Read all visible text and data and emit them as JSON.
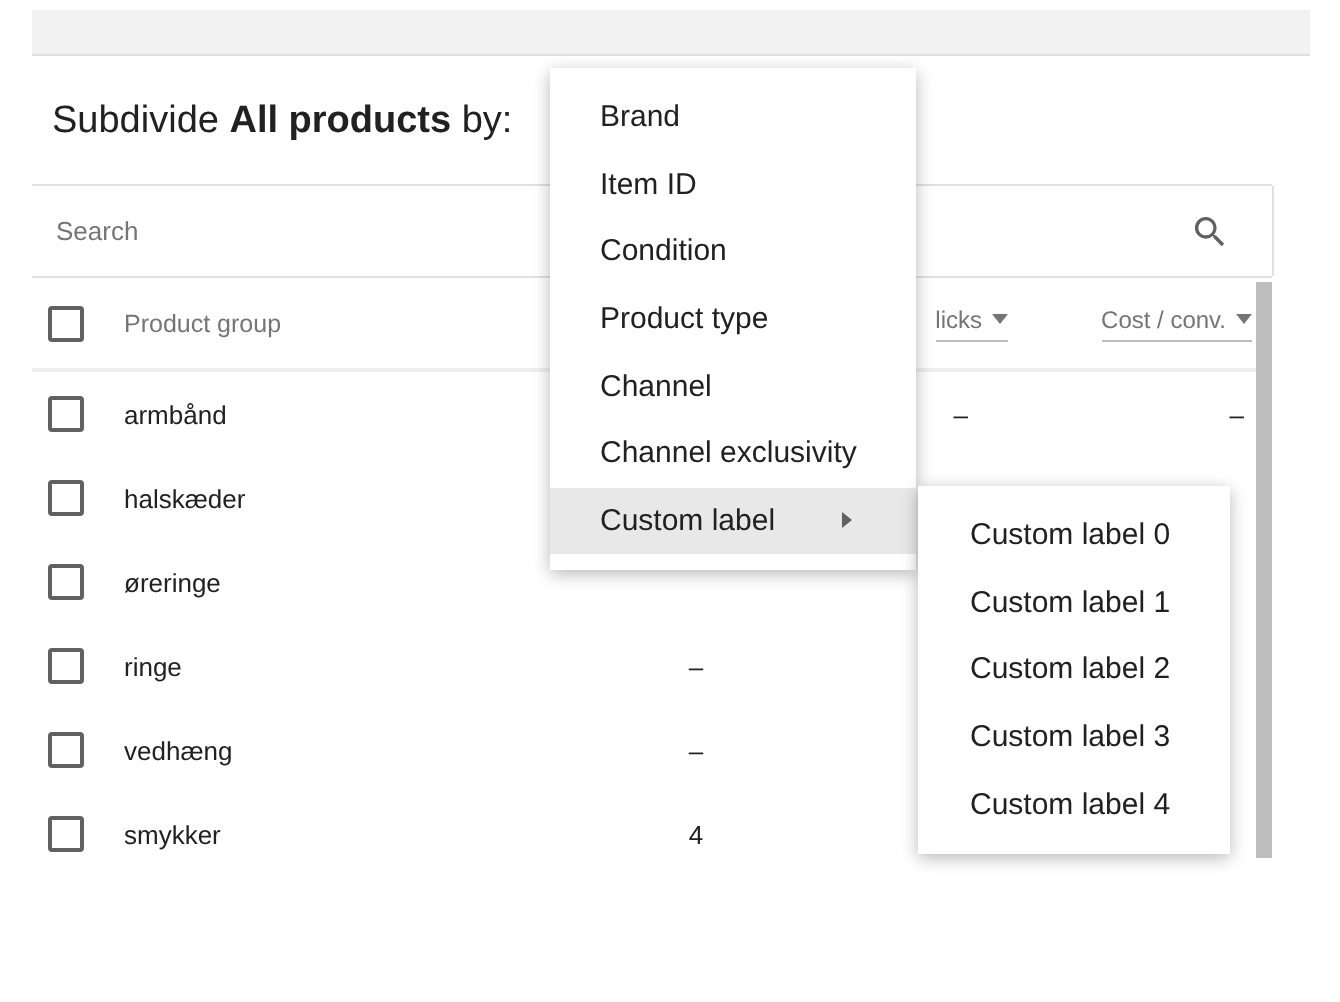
{
  "title": "Subdivide **All products** by:",
  "search": {
    "placeholder": "Search"
  },
  "table": {
    "header_checked": false,
    "columns": [
      {
        "label": "Product group",
        "sortable": false
      },
      {
        "label": "licks",
        "sortable": true
      },
      {
        "label": "Cost / conv.",
        "sortable": true
      }
    ],
    "rows": [
      {
        "name": "armbånd",
        "checked": false,
        "clicks": "–",
        "cost": "–"
      },
      {
        "name": "halskæder",
        "checked": false
      },
      {
        "name": "øreringe",
        "checked": false
      },
      {
        "name": "ringe",
        "checked": false,
        "column_2": "–"
      },
      {
        "name": "vedhæng",
        "checked": false,
        "column_2": "–"
      },
      {
        "name": "smykker",
        "checked": false,
        "column_2": "4"
      }
    ]
  },
  "menu": {
    "items": [
      {
        "label": "Brand",
        "selected": false,
        "has_submenu": false
      },
      {
        "label": "Item ID",
        "selected": false,
        "has_submenu": false
      },
      {
        "label": "Condition",
        "selected": false,
        "has_submenu": false
      },
      {
        "label": "Product type",
        "selected": false,
        "has_submenu": false
      },
      {
        "label": "Channel",
        "selected": false,
        "has_submenu": false
      },
      {
        "label": "Channel exclusivity",
        "selected": false,
        "has_submenu": false
      },
      {
        "label": "Custom label",
        "selected": true,
        "has_submenu": true
      }
    ]
  },
  "submenu": {
    "items": [
      "Custom label 0",
      "Custom label 1",
      "Custom label 2",
      "Custom label 3",
      "Custom label 4"
    ]
  }
}
